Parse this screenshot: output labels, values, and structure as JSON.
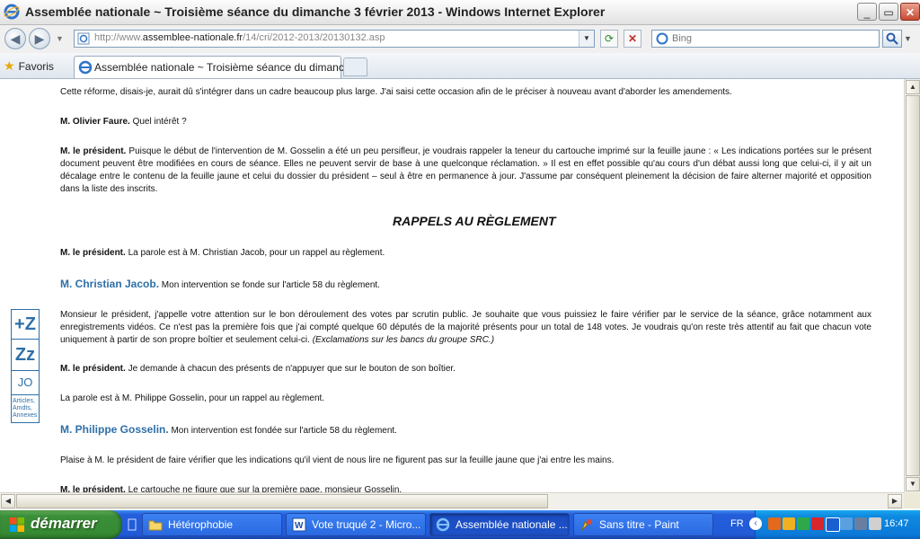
{
  "window": {
    "title": "Assemblée nationale ~ Troisième séance du dimanche 3 février 2013 - Windows Internet Explorer",
    "controls": {
      "minimize": "_",
      "maximize": "▭",
      "close": "✕"
    }
  },
  "address_bar": {
    "url_prefix": "http://www.",
    "url_domain": "assemblee-nationale.fr",
    "url_path": "/14/cri/2012-2013/20130132.asp",
    "search_placeholder": "Bing"
  },
  "favorites_bar": {
    "favorites_label": "Favoris",
    "tab_label": "Assemblée nationale ~ Troisième séance du dimanche..."
  },
  "article": {
    "p1": "Cette réforme, disais-je, aurait dû s'intégrer dans un cadre beaucoup plus large. J'ai saisi cette occasion afin de le préciser à nouveau avant d'aborder les amendements.",
    "p2_speaker": "M. Olivier Faure.",
    "p2_text": " Quel intérêt ?",
    "p3_speaker": "M. le président.",
    "p3_text": " Puisque le début de l'intervention de M. Gosselin a été un peu persifleur, je voudrais rappeler la teneur du cartouche imprimé sur la feuille jaune : « Les indications portées sur le présent document peuvent être modifiées en cours de séance. Elles ne peuvent servir de base à une quelconque réclamation. » Il est en effet possible qu'au cours d'un débat aussi long que celui-ci, il y ait un décalage entre le contenu de la feuille jaune et celui du dossier du président – seul à être en permanence à jour. J'assume par conséquent pleinement la décision de faire alterner majorité et opposition dans la liste des inscrits.",
    "section_title": "RAPPELS AU RÈGLEMENT",
    "p4_speaker": "M. le président.",
    "p4_text": " La parole est à M. Christian Jacob, pour un rappel au règlement.",
    "p5_speaker": "M. Christian Jacob.",
    "p5_text": " Mon intervention se fonde sur l'article 58 du règlement.",
    "p6_text": "Monsieur le président, j'appelle votre attention sur le bon déroulement des votes par scrutin public. Je souhaite que vous puissiez le faire vérifier par le service de la séance, grâce notamment aux enregistrements vidéos. Ce n'est pas la première fois que j'ai compté quelque 60 députés de la majorité présents pour un total de 148 votes. Je voudrais qu'on reste très attentif au fait que chacun vote uniquement à partir de son propre boîtier et seulement celui-ci. ",
    "p6_note": "(Exclamations sur les bancs du groupe SRC.)",
    "p7_speaker": "M. le président.",
    "p7_text": " Je demande à chacun des présents de n'appuyer que sur le bouton de son boîtier.",
    "p8_text": "La parole est à M. Philippe Gosselin, pour un rappel au règlement.",
    "p9_speaker": "M. Philippe Gosselin.",
    "p9_text": " Mon intervention est fondée sur l'article 58 du règlement.",
    "p10_text": "Plaise à M. le président de faire vérifier que les indications qu'il vient de nous lire ne figurent pas sur la feuille jaune que j'ai entre les mains.",
    "p11_speaker": "M. le président.",
    "p11_text": " Le cartouche ne figure que sur la première page, monsieur Gosselin."
  },
  "side_tools": {
    "zoom_text": "+Z",
    "sleep": "Zz",
    "jo": "JO",
    "articles": "Articles, Amdts, Annexes"
  },
  "taskbar": {
    "start_label": "démarrer",
    "tasks": [
      {
        "label": "Hétérophobie",
        "icon": "folder-icon"
      },
      {
        "label": "Vote truqué 2 - Micro...",
        "icon": "word-icon"
      },
      {
        "label": "Assemblée nationale ...",
        "icon": "ie-icon"
      },
      {
        "label": "Sans titre - Paint",
        "icon": "paint-icon"
      }
    ],
    "language": "FR",
    "clock": "16:47"
  },
  "colors": {
    "deputy_link": "#2e6fa8",
    "taskbar": "#245edb",
    "start_button": "#3c8f3a"
  }
}
